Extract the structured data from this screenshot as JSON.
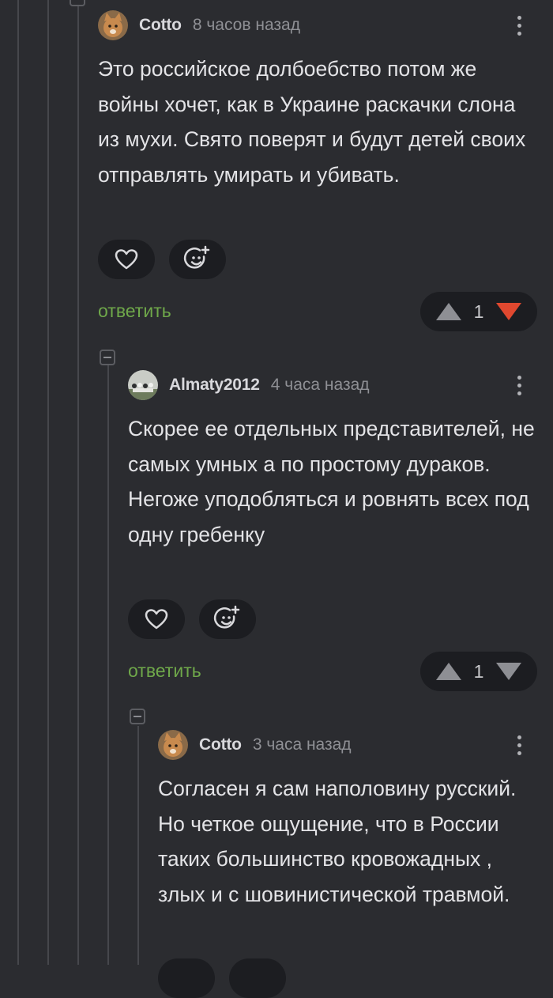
{
  "colors": {
    "background": "#2b2c30",
    "reply_link": "#6fa84a",
    "downvote_active": "#e0482f",
    "button_bg": "#1c1d21"
  },
  "comments": [
    {
      "author": "Cotto",
      "time": "8 часов назад",
      "text": "Это российское долбоебство потом же войны хочет, как в Украине раскачки слона из мухи. Свято поверят и будут детей своих отправлять умирать и убивать.",
      "reply_label": "ответить",
      "score": "1",
      "downvoted": true,
      "avatar_icon": "cat-avatar-icon"
    },
    {
      "author": "Almaty2012",
      "time": "4 часа назад",
      "text": "Скорее ее отдельных представителей, не самых умных а по простому дураков. Негоже уподобляться и ровнять всех под одну гребенку",
      "reply_label": "ответить",
      "score": "1",
      "downvoted": false,
      "avatar_icon": "photo-avatar-icon"
    },
    {
      "author": "Cotto",
      "time": "3 часа назад",
      "text": "Согласен я сам наполовину русский. Но четкое ощущение, что в России таких большинство кровожадных , злых и с шовинистической травмой.",
      "avatar_icon": "cat-avatar-icon"
    }
  ]
}
